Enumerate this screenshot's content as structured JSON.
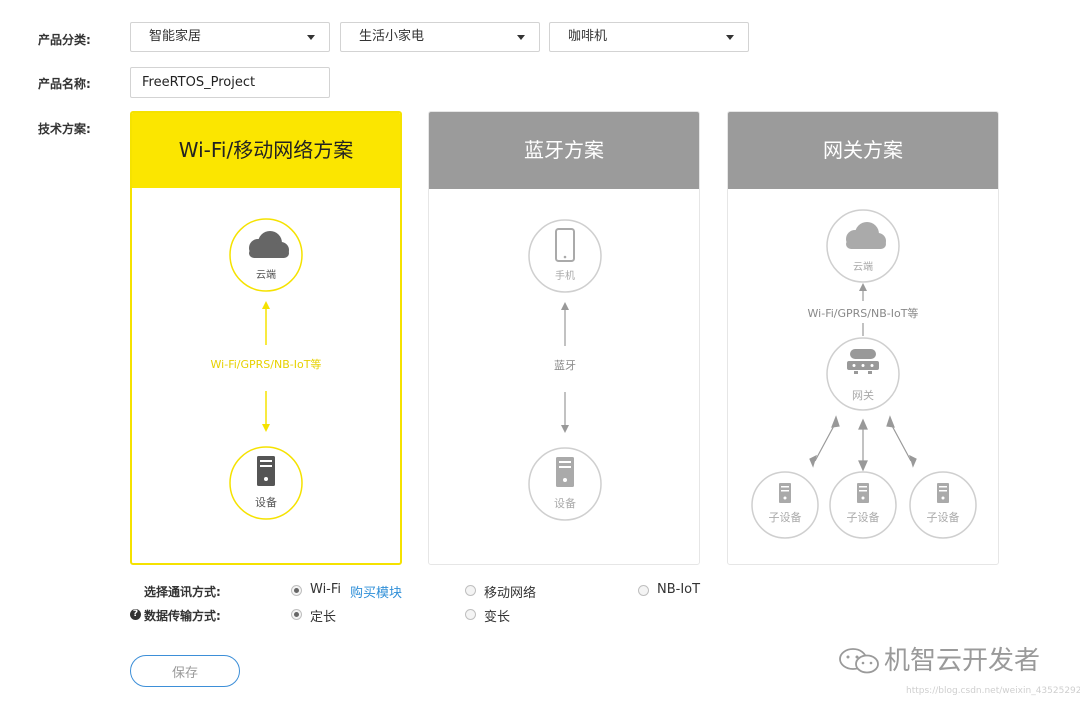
{
  "form": {
    "category_label": "产品分类:",
    "name_label": "产品名称:",
    "tech_label": "技术方案:",
    "categories": [
      "智能家居",
      "生活小家电",
      "咖啡机"
    ],
    "product_name": "FreeRTOS_Project"
  },
  "cards": [
    {
      "title": "Wi-Fi/移动网络方案",
      "top_node": "云端",
      "link": "Wi-Fi/GPRS/NB-IoT等",
      "bottom_node": "设备"
    },
    {
      "title": "蓝牙方案",
      "top_node": "手机",
      "link": "蓝牙",
      "bottom_node": "设备"
    },
    {
      "title": "网关方案",
      "top_node": "云端",
      "link": "Wi-Fi/GPRS/NB-IoT等",
      "middle_node": "网关",
      "sub_nodes": [
        "子设备",
        "子设备",
        "子设备"
      ]
    }
  ],
  "comm": {
    "label": "选择通讯方式:",
    "options": [
      "Wi-Fi",
      "移动网络",
      "NB-IoT"
    ],
    "buy_link": "购买模块",
    "selected": "Wi-Fi"
  },
  "transfer": {
    "label": "数据传输方式:",
    "options": [
      "定长",
      "变长"
    ],
    "selected": "定长"
  },
  "save_label": "保存",
  "watermark": {
    "text": "机智云开发者",
    "url": "https://blog.csdn.net/weixin_43525292"
  },
  "colors": {
    "accent": "#fbe600",
    "inactive_header": "#9b9b9b",
    "link": "#2f8fd8"
  }
}
